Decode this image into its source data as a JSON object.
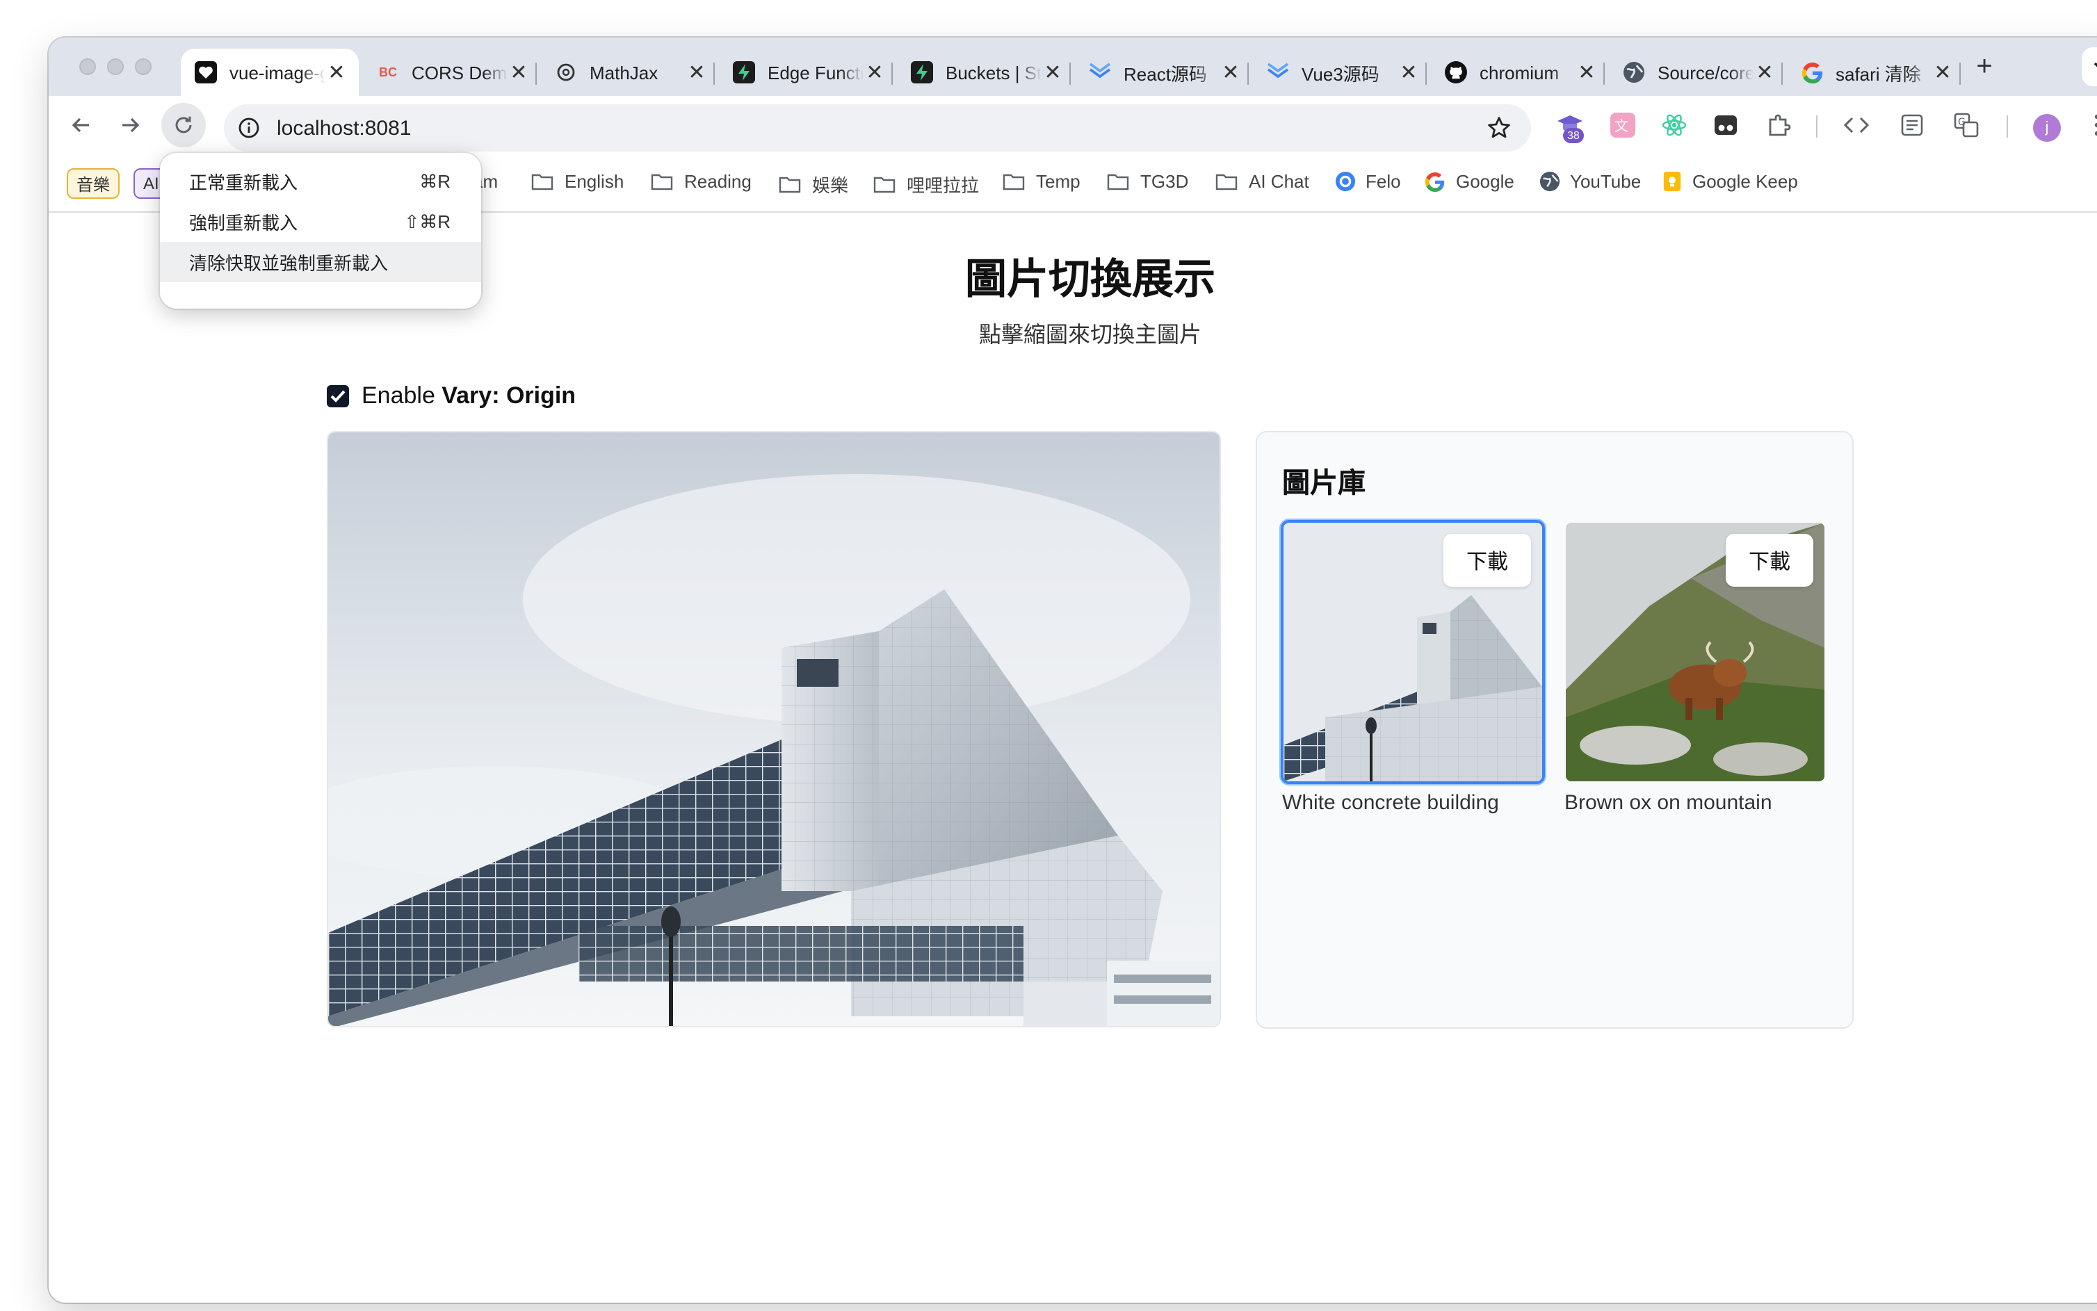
{
  "browser": {
    "tabs": [
      {
        "title": "vue-image-gallery",
        "icon": "heart-icon",
        "active": true
      },
      {
        "title": "CORS Demo",
        "icon": "bc-logo-icon"
      },
      {
        "title": "MathJax",
        "icon": "openai-icon"
      },
      {
        "title": "Edge Functions",
        "icon": "bolt-icon"
      },
      {
        "title": "Buckets | Storage",
        "icon": "bolt-icon"
      },
      {
        "title": "React源码",
        "icon": "layers-icon"
      },
      {
        "title": "Vue3源码",
        "icon": "layers-icon"
      },
      {
        "title": "chromium",
        "icon": "github-icon"
      },
      {
        "title": "Source/core",
        "icon": "globe-icon"
      },
      {
        "title": "safari 清除",
        "icon": "google-icon"
      }
    ],
    "new_tab": "+",
    "tab_close": "✕",
    "url": "localhost:8081",
    "extension_badge": "38",
    "avatar_letter": "j",
    "bookmarks": {
      "chips": [
        "音樂",
        "AI"
      ],
      "items": [
        {
          "label": "am",
          "type": "folder"
        },
        {
          "label": "English",
          "type": "folder"
        },
        {
          "label": "Reading",
          "type": "folder"
        },
        {
          "label": "娛樂",
          "type": "folder"
        },
        {
          "label": "哩哩拉拉",
          "type": "folder"
        },
        {
          "label": "Temp",
          "type": "folder"
        },
        {
          "label": "TG3D",
          "type": "folder"
        },
        {
          "label": "AI Chat",
          "type": "folder"
        },
        {
          "label": "Felo",
          "type": "link"
        },
        {
          "label": "Google",
          "type": "link"
        },
        {
          "label": "YouTube",
          "type": "link"
        },
        {
          "label": "Google Keep",
          "type": "link"
        }
      ]
    },
    "reload_menu": {
      "items": [
        {
          "label": "正常重新載入",
          "shortcut": "⌘R"
        },
        {
          "label": "強制重新載入",
          "shortcut": "⇧⌘R"
        },
        {
          "label": "清除快取並強制重新載入",
          "shortcut": ""
        }
      ],
      "highlighted_index": 2
    }
  },
  "page": {
    "title": "圖片切換展示",
    "subtitle": "點擊縮圖來切換主圖片",
    "vary_option": {
      "prefix": "Enable ",
      "bold": "Vary: Origin",
      "checked": true
    },
    "gallery": {
      "title": "圖片庫",
      "download_label": "下載",
      "images": [
        {
          "caption": "White concrete building",
          "selected": true
        },
        {
          "caption": "Brown ox on mountain",
          "selected": false
        }
      ]
    }
  },
  "colors": {
    "accent_blue": "#3b82f6",
    "checkbox": "#111827",
    "tabstrip": "#dfe3eb"
  }
}
